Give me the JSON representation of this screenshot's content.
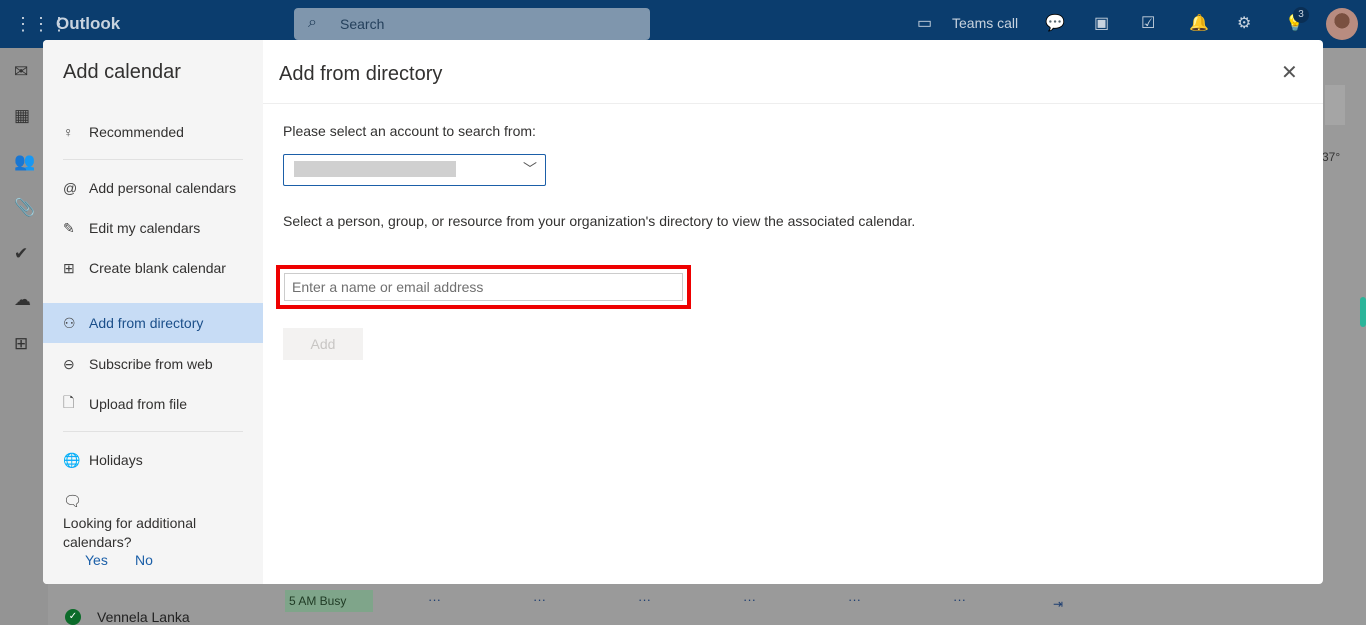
{
  "header": {
    "app_name": "Outlook",
    "search_placeholder": "Search",
    "teams_call": "Teams call",
    "notifications_badge": "3"
  },
  "modal": {
    "left_title": "Add calendar",
    "items": [
      {
        "label": "Recommended",
        "icon": "lightbulb-icon"
      },
      {
        "label": "Add personal calendars",
        "icon": "at-icon"
      },
      {
        "label": "Edit my calendars",
        "icon": "edit-icon"
      },
      {
        "label": "Create blank calendar",
        "icon": "calendar-add-icon"
      },
      {
        "label": "Add from directory",
        "icon": "people-icon",
        "selected": true
      },
      {
        "label": "Subscribe from web",
        "icon": "link-icon"
      },
      {
        "label": "Upload from file",
        "icon": "file-icon"
      },
      {
        "label": "Holidays",
        "icon": "globe-icon"
      }
    ],
    "feedback": {
      "text": "Looking for additional calendars?",
      "yes": "Yes",
      "no": "No"
    },
    "title": "Add from directory",
    "account_label": "Please select an account to search from:",
    "directory_label": "Select a person, group, or resource from your organization's directory to view the associated calendar.",
    "name_placeholder": "Enter a name or email address",
    "add_button": "Add"
  },
  "background": {
    "busy": "5 AM Busy",
    "person": "Vennela Lanka",
    "temp": "37°"
  },
  "colors": {
    "header": "#0f4a85",
    "selected": "#c7dcf5",
    "highlight": "#e00000"
  }
}
